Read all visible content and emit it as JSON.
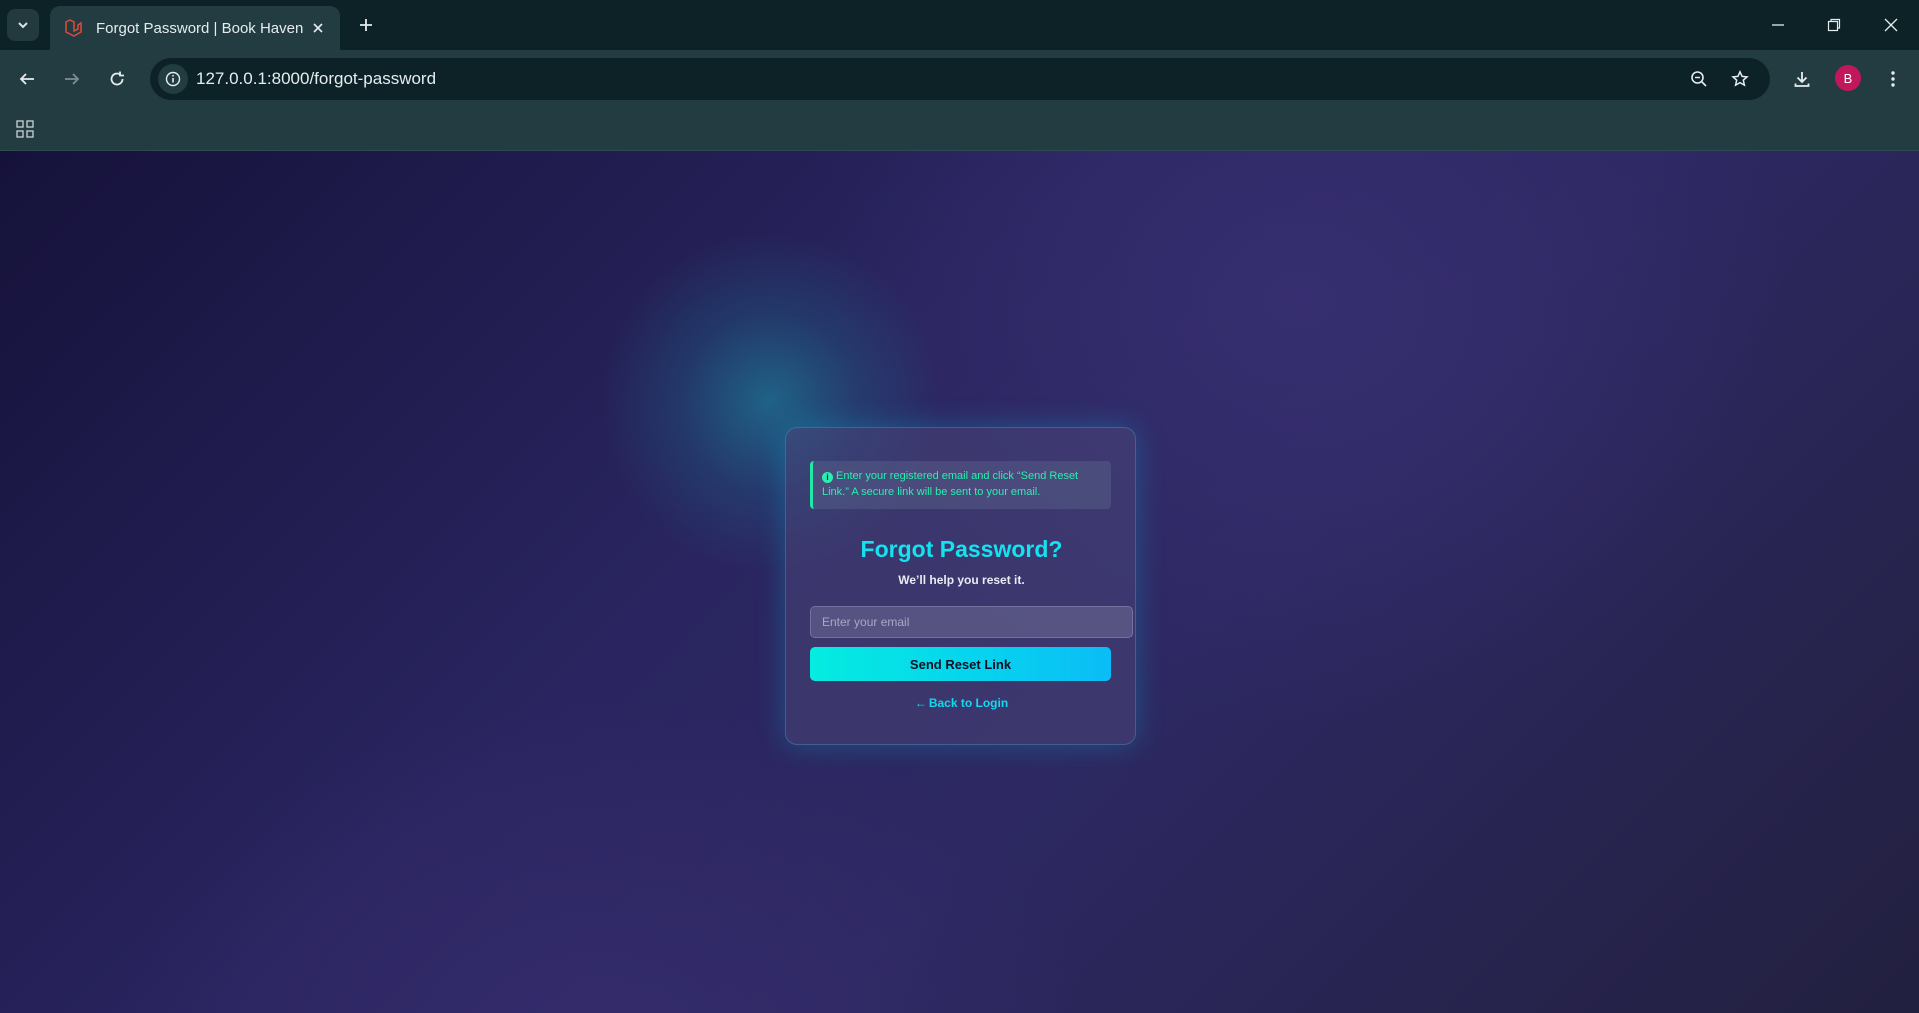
{
  "browser": {
    "tab_title": "Forgot Password | Book Haven",
    "url": "127.0.0.1:8000/forgot-password",
    "profile_initial": "B"
  },
  "alert": {
    "icon": "info-circle-icon",
    "text": "Enter your registered email and click “Send Reset Link.” A secure link will be sent to your email."
  },
  "form": {
    "title": "Forgot Password?",
    "subtitle": "We’ll help you reset it.",
    "email_placeholder": "Enter your email",
    "email_value": "",
    "submit_label": "Send Reset Link",
    "back_label": "Back to Login"
  },
  "colors": {
    "accent": "#13e3f0",
    "alert_text": "#28f0b0",
    "avatar": "#c2185b"
  }
}
